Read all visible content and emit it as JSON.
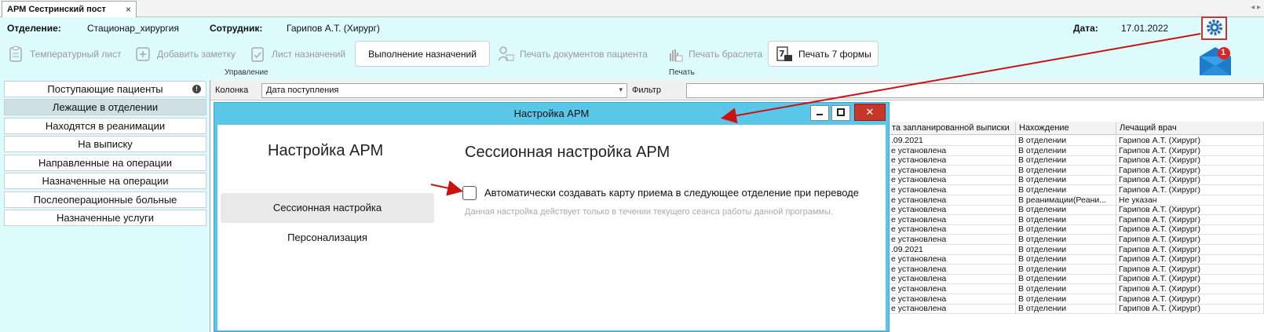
{
  "tab": {
    "title": "АРМ Сестринский пост",
    "close": "×",
    "nav": "◂ ▸"
  },
  "header": {
    "dept_label": "Отделение:",
    "dept_value": "Стационар_хирургия",
    "emp_label": "Сотрудник:",
    "emp_value": "Гарипов А.Т. (Хирург)",
    "date_label": "Дата:",
    "date_value": "17.01.2022"
  },
  "toolbar": {
    "temp_sheet": "Температурный лист",
    "add_note": "Добавить заметку",
    "orders_sheet": "Лист назначений",
    "execute_orders": "Выполнение назначений",
    "print_docs": "Печать документов пациента",
    "print_bracelet": "Печать браслета",
    "print_form7": "Печать 7 формы",
    "group_manage": "Управление",
    "group_print": "Печать"
  },
  "notifications": {
    "count": "1"
  },
  "nav": {
    "items": [
      "Поступающие пациенты",
      "Лежащие в отделении",
      "Находятся в реанимации",
      "На выписку",
      "Направленные на операции",
      "Назначенные на операции",
      "Послеоперационные больные",
      "Назначенные услуги"
    ],
    "info_glyph": "!"
  },
  "filter": {
    "column_label": "Колонка",
    "column_value": "Дата поступления",
    "filter_label": "Фильтр",
    "arrow": "▾"
  },
  "grid": {
    "headers": [
      "та запланированной выписки",
      "Нахождение",
      "Лечащий врач"
    ],
    "rows": [
      [
        ".09.2021",
        "В отделении",
        "Гарипов А.Т. (Хирург)"
      ],
      [
        "е установлена",
        "В отделении",
        "Гарипов А.Т. (Хирург)"
      ],
      [
        "е установлена",
        "В отделении",
        "Гарипов А.Т. (Хирург)"
      ],
      [
        "е установлена",
        "В отделении",
        "Гарипов А.Т. (Хирург)"
      ],
      [
        "е установлена",
        "В отделении",
        "Гарипов А.Т. (Хирург)"
      ],
      [
        "е установлена",
        "В отделении",
        "Гарипов А.Т. (Хирург)"
      ],
      [
        "е установлена",
        "В реанимации(Реани...",
        "Не указан"
      ],
      [
        "е установлена",
        "В отделении",
        "Гарипов А.Т. (Хирург)"
      ],
      [
        "е установлена",
        "В отделении",
        "Гарипов А.Т. (Хирург)"
      ],
      [
        "е установлена",
        "В отделении",
        "Гарипов А.Т. (Хирург)"
      ],
      [
        "е установлена",
        "В отделении",
        "Гарипов А.Т. (Хирург)"
      ],
      [
        ".09.2021",
        "В отделении",
        "Гарипов А.Т. (Хирург)"
      ],
      [
        "е установлена",
        "В отделении",
        "Гарипов А.Т. (Хирург)"
      ],
      [
        "е установлена",
        "В отделении",
        "Гарипов А.Т. (Хирург)"
      ],
      [
        "е установлена",
        "В отделении",
        "Гарипов А.Т. (Хирург)"
      ],
      [
        "е установлена",
        "В отделении",
        "Гарипов А.Т. (Хирург)"
      ],
      [
        "е установлена",
        "В отделении",
        "Гарипов А.Т. (Хирург)"
      ],
      [
        "е установлена",
        "В отделении",
        "Гарипов А.Т. (Хирург)"
      ]
    ]
  },
  "dialog": {
    "title": "Настройка АРМ",
    "close": "✕",
    "side_title": "Настройка АРМ",
    "side_items": [
      "Сессионная настройка",
      "Персонализация"
    ],
    "main_title": "Сессионная настройка АРМ",
    "checkbox_label": "Автоматически создавать карту приема в следующее отделение при переводе",
    "hint": "Данная настройка действует только в течении текущего сеанса работы данной программы."
  },
  "colors": {
    "header_bg": "#ddfbfd",
    "dialog_title_bg": "#5bc7e8",
    "close_red": "#c7362b",
    "annotation_red": "#cc1111"
  }
}
